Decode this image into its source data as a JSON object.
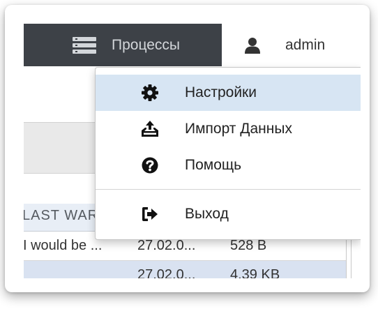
{
  "navbar": {
    "processes_label": "Процессы",
    "user_label": "admin"
  },
  "dropdown": {
    "items": [
      {
        "label": "Настройки",
        "icon": "gear-icon",
        "active": true
      },
      {
        "label": "Импорт Данных",
        "icon": "upload-tray-icon",
        "active": false
      },
      {
        "label": "Помощь",
        "icon": "question-circle-icon",
        "active": false
      }
    ],
    "logout": {
      "label": "Выход",
      "icon": "sign-out-icon"
    }
  },
  "table": {
    "header_fragment": "LAST WAR",
    "rows": [
      {
        "name": "I would be ...",
        "date": "27.02.0...",
        "size": "528 B"
      },
      {
        "name": "",
        "date": "27.02.0...",
        "size": "4.39 KB"
      }
    ]
  },
  "colors": {
    "navbar_bg": "#3d4147",
    "active_item_bg": "#d7e5f3",
    "selected_row_bg": "#d9e2f1"
  }
}
